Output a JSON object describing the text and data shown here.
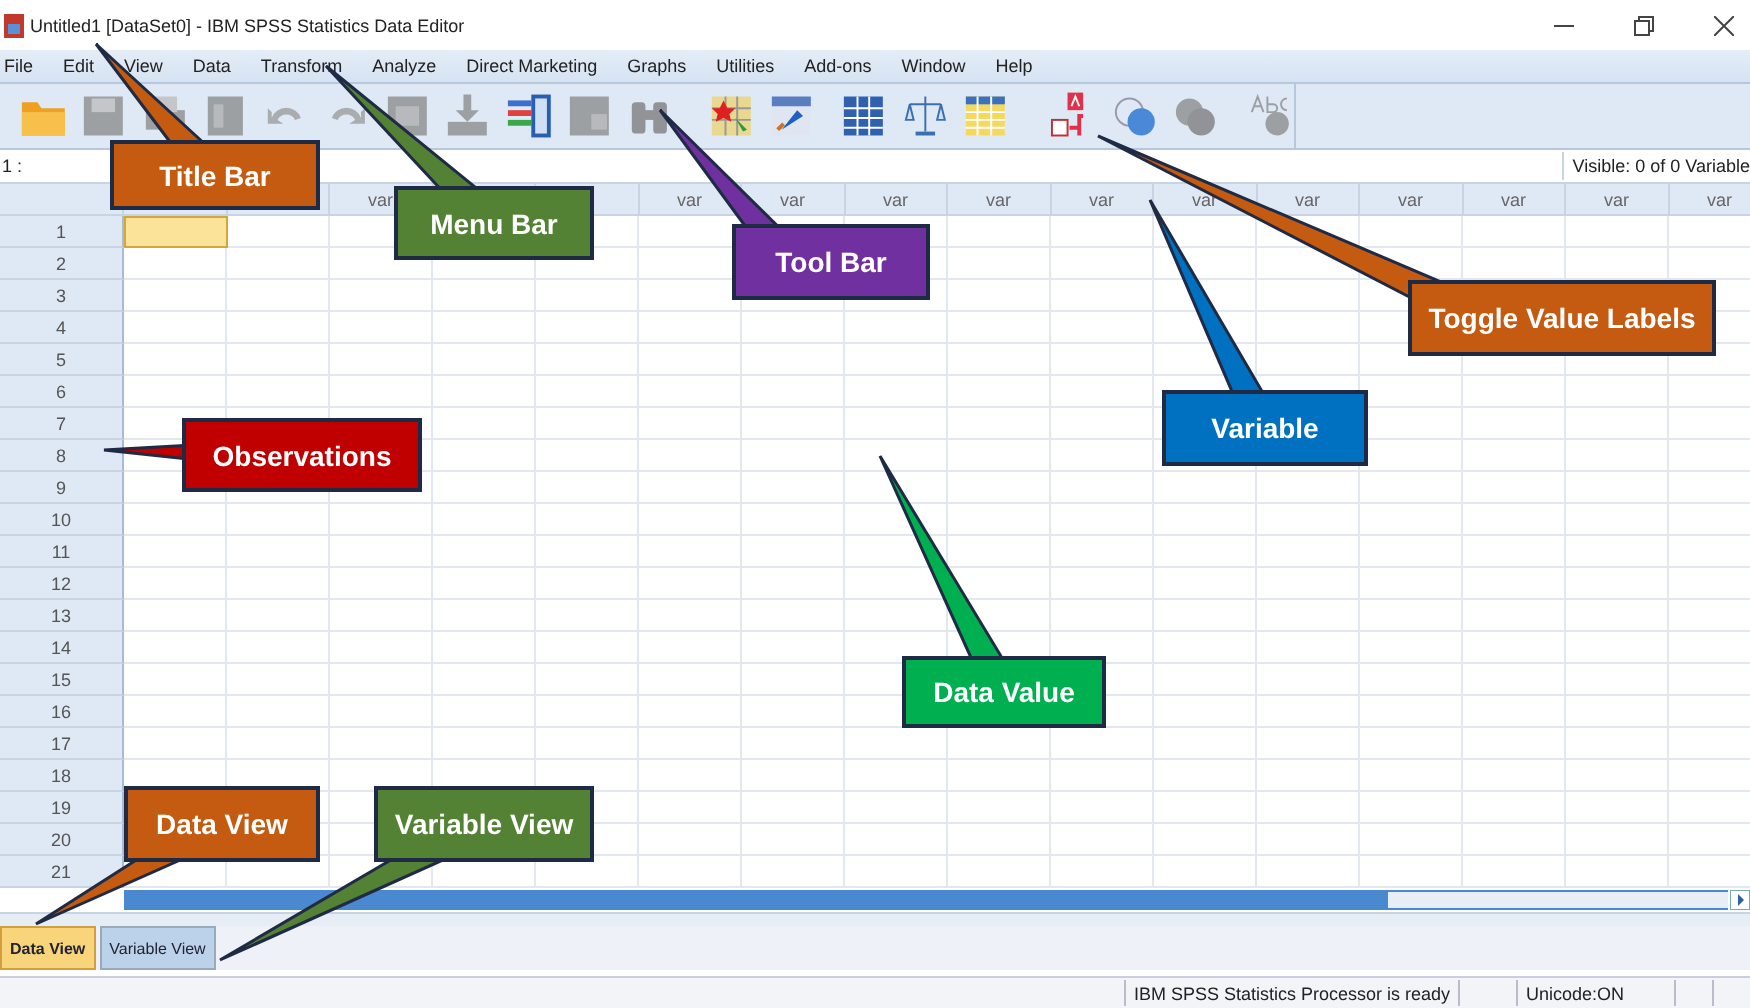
{
  "window": {
    "title": "Untitled1 [DataSet0] - IBM SPSS Statistics Data Editor"
  },
  "menu": [
    "File",
    "Edit",
    "View",
    "Data",
    "Transform",
    "Analyze",
    "Direct Marketing",
    "Graphs",
    "Utilities",
    "Add-ons",
    "Window",
    "Help"
  ],
  "toolbar": [
    {
      "kind": "folder",
      "disabled": false
    },
    {
      "kind": "save",
      "disabled": true
    },
    {
      "kind": "print",
      "disabled": true
    },
    {
      "kind": "dialog",
      "disabled": true
    },
    {
      "kind": "undo",
      "disabled": true
    },
    {
      "kind": "redo",
      "disabled": true
    },
    {
      "kind": "goto",
      "disabled": true
    },
    {
      "kind": "download",
      "disabled": true
    },
    {
      "kind": "variables",
      "disabled": false
    },
    {
      "kind": "grid",
      "disabled": true
    },
    {
      "kind": "binoculars",
      "disabled": true
    },
    {
      "kind": "insert-case",
      "disabled": false
    },
    {
      "kind": "insert-variable",
      "disabled": false
    },
    {
      "kind": "split",
      "disabled": false
    },
    {
      "kind": "scale",
      "disabled": false
    },
    {
      "kind": "table",
      "disabled": false
    },
    {
      "kind": "value-labels",
      "disabled": false
    },
    {
      "kind": "sets",
      "disabled": false
    },
    {
      "kind": "circles",
      "disabled": true
    },
    {
      "kind": "spell",
      "disabled": true
    }
  ],
  "cell_ref": "1 :",
  "visible_count": "Visible: 0 of 0 Variable",
  "columns": [
    {},
    {},
    {
      "label": "var"
    },
    {},
    {},
    {
      "label": "var"
    },
    {
      "label": "var"
    },
    {
      "label": "var"
    },
    {
      "label": "var"
    },
    {
      "label": "var"
    },
    {
      "label": "var"
    },
    {
      "label": "var"
    },
    {
      "label": "var"
    },
    {
      "label": "var"
    },
    {
      "label": "var"
    },
    {
      "label": "var"
    }
  ],
  "rows": [
    {
      "label": "1",
      "selected": true
    },
    {
      "label": "2",
      "selected": false
    },
    {
      "label": "3",
      "selected": false
    },
    {
      "label": "4",
      "selected": false
    },
    {
      "label": "5",
      "selected": false
    },
    {
      "label": "6",
      "selected": false
    },
    {
      "label": "7",
      "selected": false
    },
    {
      "label": "8",
      "selected": false
    },
    {
      "label": "9",
      "selected": false
    },
    {
      "label": "10",
      "selected": false
    },
    {
      "label": "11",
      "selected": false
    },
    {
      "label": "12",
      "selected": false
    },
    {
      "label": "13",
      "selected": false
    },
    {
      "label": "14",
      "selected": false
    },
    {
      "label": "15",
      "selected": false
    },
    {
      "label": "16",
      "selected": false
    },
    {
      "label": "17",
      "selected": false
    },
    {
      "label": "18",
      "selected": false
    },
    {
      "label": "19",
      "selected": false
    },
    {
      "label": "20",
      "selected": false
    },
    {
      "label": "21",
      "selected": false
    }
  ],
  "tabs": [
    {
      "label": "Data View",
      "selected": true
    },
    {
      "label": "Variable View",
      "selected": false
    }
  ],
  "status_bar": [
    "IBM SPSS Statistics Processor is ready",
    "Unicode:ON"
  ],
  "callouts": [
    {
      "text": "Title Bar",
      "color": "#c55a11"
    },
    {
      "text": "Menu Bar",
      "color": "#548235"
    },
    {
      "text": "Tool Bar",
      "color": "#7030a0"
    },
    {
      "text": "Toggle Value Labels",
      "color": "#c55a11"
    },
    {
      "text": "Variable",
      "color": "#0070c0"
    },
    {
      "text": "Observations",
      "color": "#c00000"
    },
    {
      "text": "Data Value",
      "color": "#00b050"
    },
    {
      "text": "Data View",
      "color": "#c55a11"
    },
    {
      "text": "Variable View",
      "color": "#548235"
    }
  ]
}
